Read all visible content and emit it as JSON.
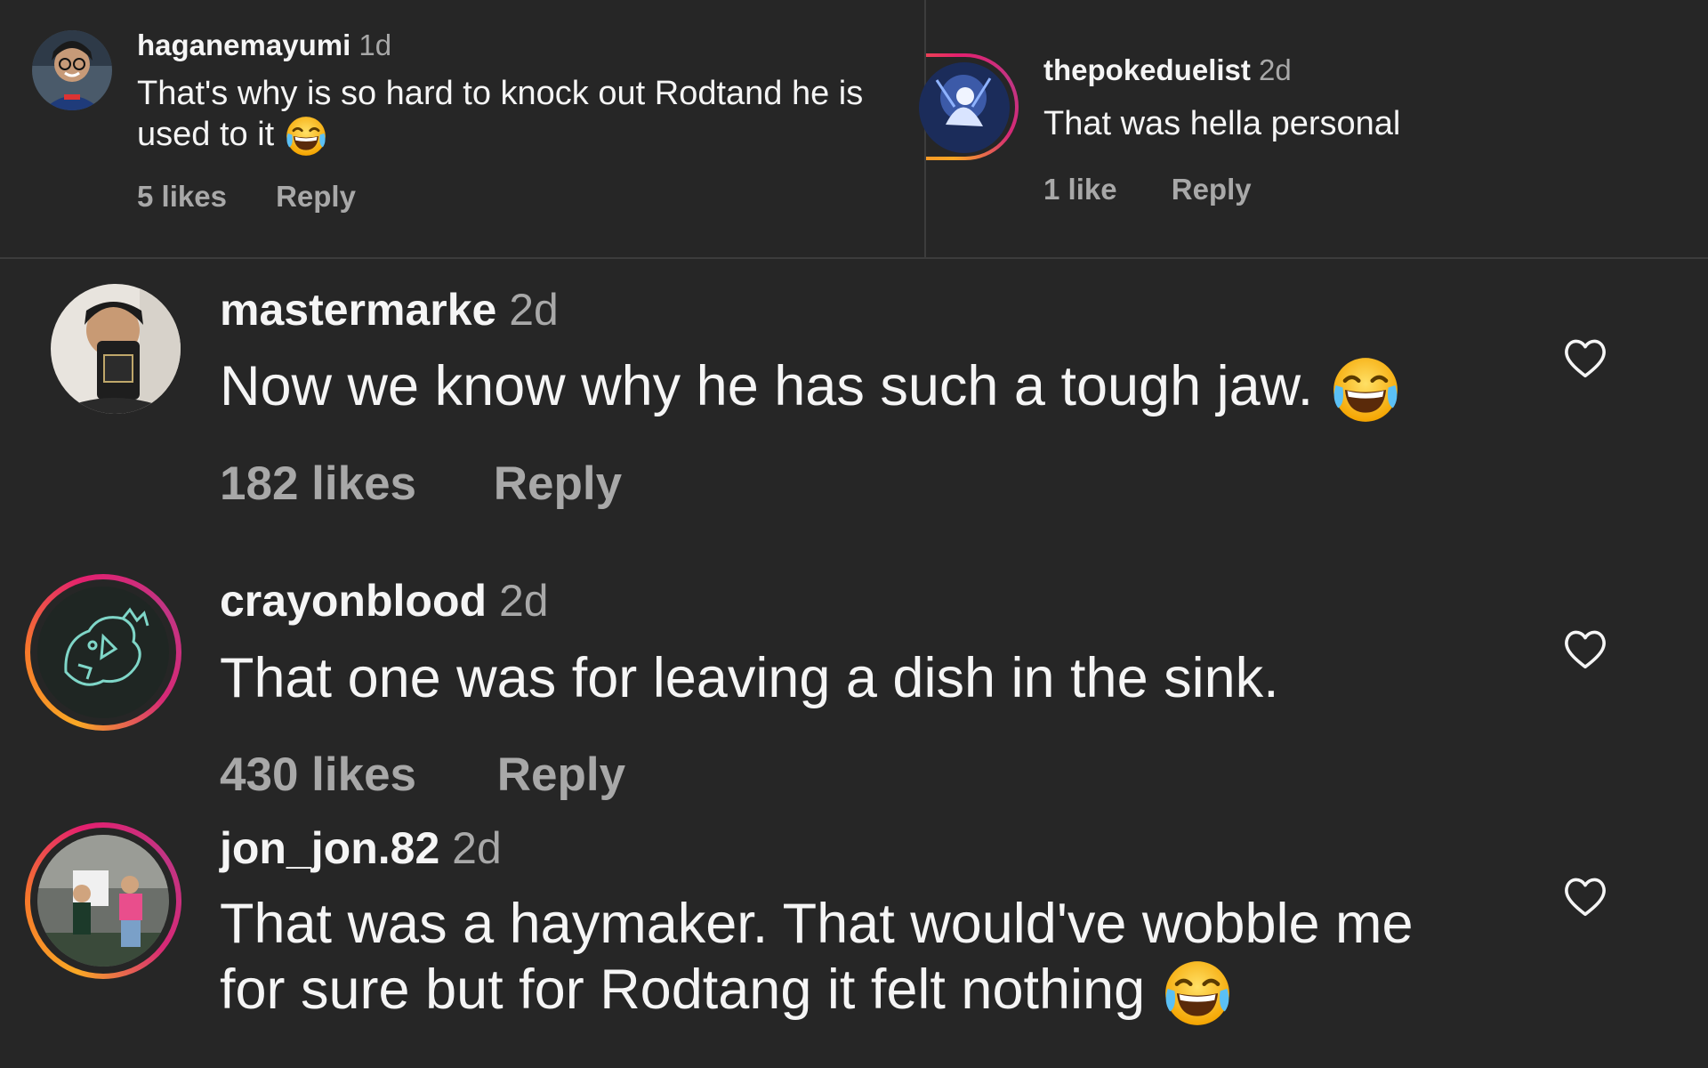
{
  "comments_top": [
    {
      "username": "haganemayumi",
      "time": "1d",
      "text": "That's why is so hard to knock out Rodtand he is used to it",
      "emoji": "face-with-tears-of-joy",
      "likes": "5 likes",
      "reply": "Reply"
    },
    {
      "username": "thepokeduelist",
      "time": "2d",
      "text": "That was hella personal",
      "likes": "1 like",
      "reply": "Reply"
    }
  ],
  "comments_main": [
    {
      "username": "mastermarke",
      "time": "2d",
      "text": "Now we know why he has such a tough jaw.",
      "emoji": "face-with-tears-of-joy",
      "likes": "182 likes",
      "reply": "Reply"
    },
    {
      "username": "crayonblood",
      "time": "2d",
      "text": "That one was for leaving a dish in the sink.",
      "likes": "430 likes",
      "reply": "Reply"
    },
    {
      "username": "jon_jon.82",
      "time": "2d",
      "text": "That was a haymaker. That would've wobble me for sure but for Rodtang it felt nothing",
      "emoji": "face-with-tears-of-joy"
    }
  ],
  "icons": {
    "heart": "heart-outline-icon",
    "emoji": "face-with-tears-of-joy"
  },
  "colors": {
    "background": "#262626",
    "text": "#f5f5f5",
    "muted": "#a8a8a8",
    "story_ring_start": "#f9a825",
    "story_ring_end": "#c13584"
  }
}
